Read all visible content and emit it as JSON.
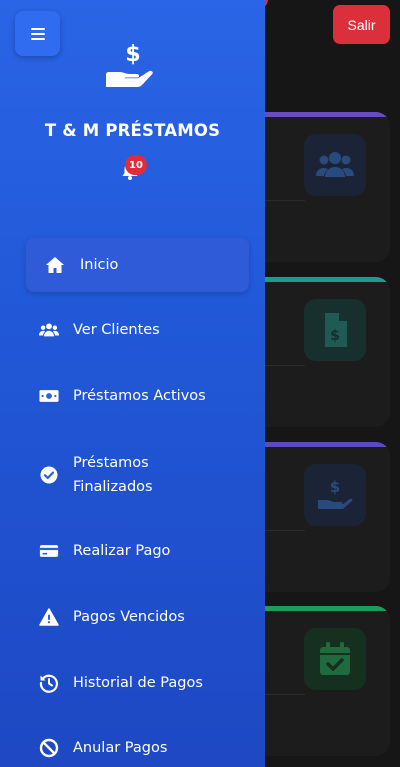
{
  "header": {
    "salir_label": "Salir",
    "top_badge": "10"
  },
  "drawer": {
    "brand": "T & M PRÉSTAMOS",
    "bell_count": "10",
    "menu_icon": "hamburger-icon",
    "logo_icon": "money-hand-icon"
  },
  "nav": {
    "items": [
      {
        "label": "Inicio",
        "icon": "home-icon",
        "active": true
      },
      {
        "label": "Ver Clientes",
        "icon": "users-icon"
      },
      {
        "label": "Préstamos Activos",
        "icon": "money-bill-icon"
      },
      {
        "label": "Préstamos Finalizados",
        "icon": "check-circle-icon"
      },
      {
        "label": "Realizar Pago",
        "icon": "credit-card-icon"
      },
      {
        "label": "Pagos Vencidos",
        "icon": "warning-icon"
      },
      {
        "label": "Historial de Pagos",
        "icon": "history-icon"
      },
      {
        "label": "Anular Pagos",
        "icon": "ban-icon"
      }
    ]
  },
  "cards": [
    {
      "icon": "users-icon",
      "accent": "#6a4bc4"
    },
    {
      "icon": "invoice-dollar-icon",
      "accent": "#1d9b8a"
    },
    {
      "icon": "money-hand-icon",
      "accent": "#5b4bc0"
    },
    {
      "icon": "calendar-check-icon",
      "accent": "#1e9c5c"
    }
  ],
  "colors": {
    "drawer_top": "#2965e6",
    "drawer_bottom": "#1e48c4",
    "danger": "#dc2f3c"
  }
}
